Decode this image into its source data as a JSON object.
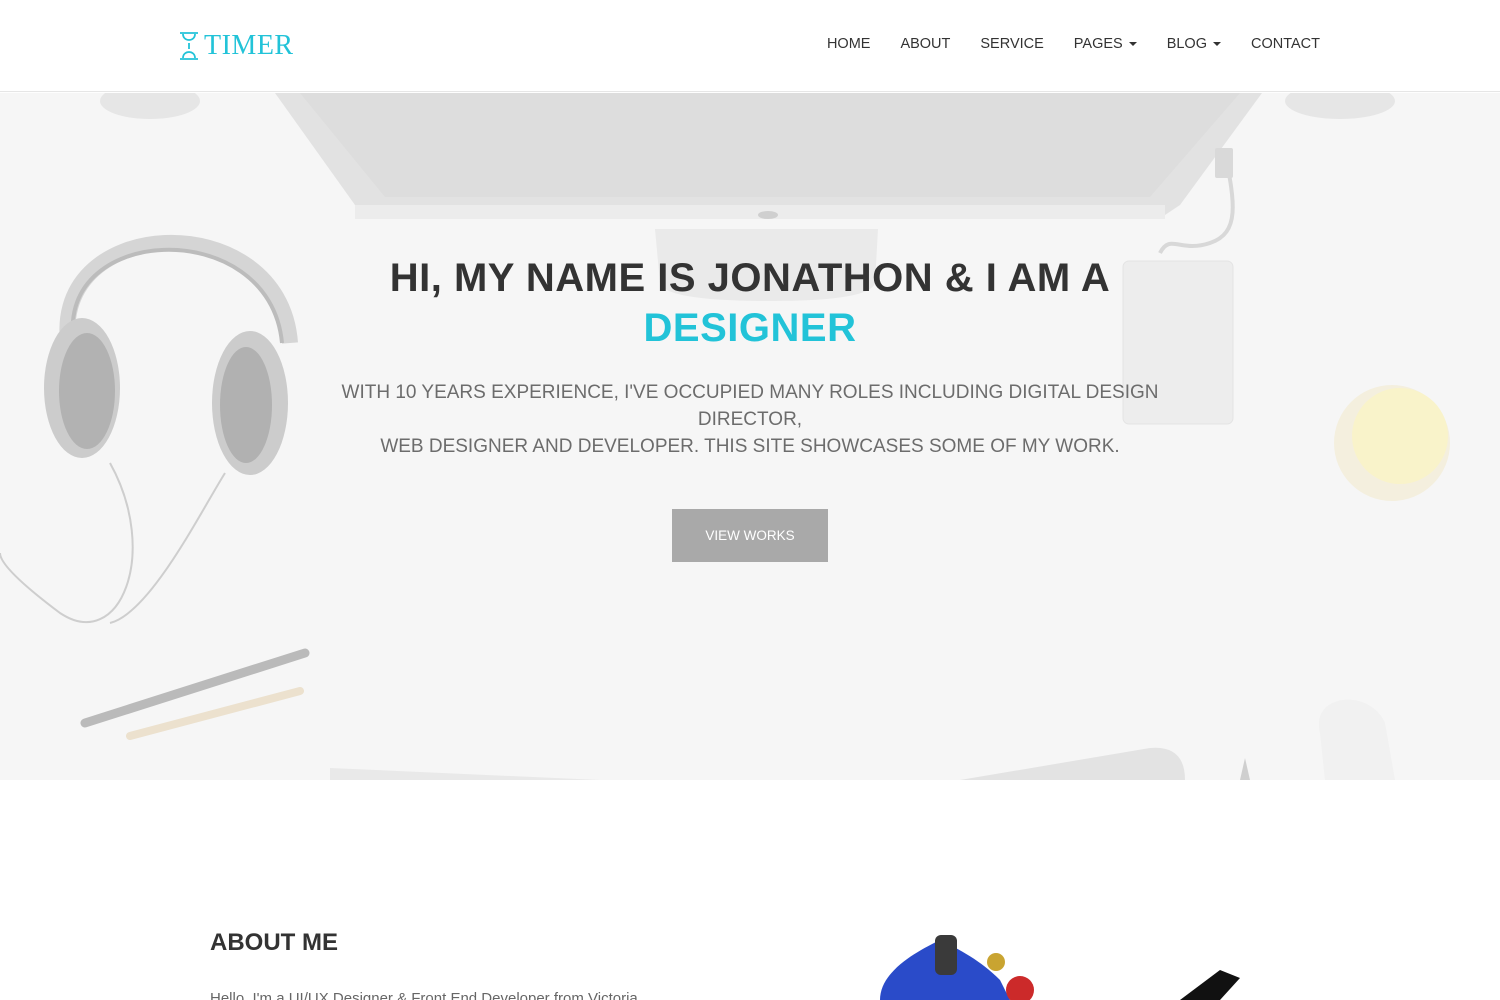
{
  "brand": {
    "name": "TIMER",
    "color": "#22c3d8"
  },
  "nav": {
    "items": [
      {
        "label": "HOME",
        "dropdown": false
      },
      {
        "label": "ABOUT",
        "dropdown": false
      },
      {
        "label": "SERVICE",
        "dropdown": false
      },
      {
        "label": "PAGES",
        "dropdown": true
      },
      {
        "label": "BLOG",
        "dropdown": true
      },
      {
        "label": "CONTACT",
        "dropdown": false
      }
    ]
  },
  "hero": {
    "title_line1": "HI, MY NAME IS JONATHON & I AM A",
    "title_accent": "DESIGNER",
    "subtitle_line1": "WITH 10 YEARS EXPERIENCE, I'VE OCCUPIED MANY ROLES INCLUDING DIGITAL DESIGN DIRECTOR,",
    "subtitle_line2": "WEB DESIGNER AND DEVELOPER. THIS SITE SHOWCASES SOME OF MY WORK.",
    "button_label": "VIEW WORKS"
  },
  "about": {
    "title": "ABOUT ME",
    "text": "Hello, I'm a UI/UX Designer & Front End Developer from Victoria"
  },
  "colors": {
    "accent": "#22c3d8",
    "button": "#a9a9a9",
    "text": "#333333"
  }
}
